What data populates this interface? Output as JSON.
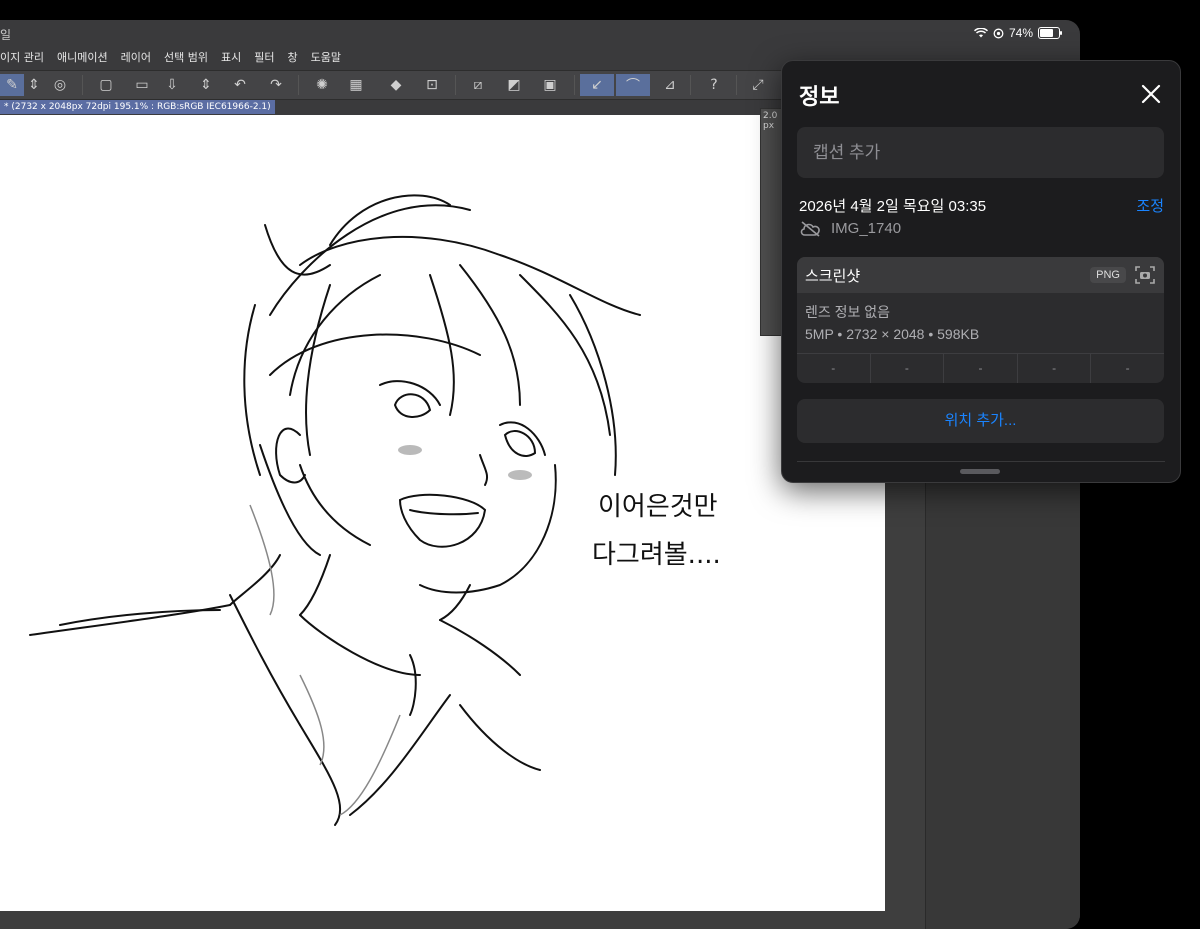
{
  "status": {
    "battery": "74%",
    "battery_level": 0.74
  },
  "app": {
    "title_fragment": "일",
    "menu": [
      "이지 관리",
      "애니메이션",
      "레이어",
      "선택 범위",
      "표시",
      "필터",
      "창",
      "도움말"
    ],
    "doc_info": "* (2732 x 2048px 72dpi 195.1% : RGB:sRGB IEC61966-2.1)",
    "side_panel_label": "2.0 px",
    "handwriting": [
      "이어은것만",
      "다그려볼...."
    ]
  },
  "info_panel": {
    "title": "정보",
    "caption_placeholder": "캡션 추가",
    "datetime": "2026년 4월 2일 목요일 03:35",
    "adjust_label": "조정",
    "filename": "IMG_1740",
    "type_label": "스크린샷",
    "format_badge": "PNG",
    "lens": "렌즈 정보 없음",
    "specs": "5MP • 2732 × 2048 • 598KB",
    "exif": [
      "-",
      "-",
      "-",
      "-",
      "-"
    ],
    "location_label": "위치 추가..."
  },
  "icons": [
    "wifi-icon",
    "battery-icon",
    "close-icon",
    "cloud-off-icon",
    "screenshot-camera-icon",
    "undo-icon",
    "redo-icon"
  ]
}
